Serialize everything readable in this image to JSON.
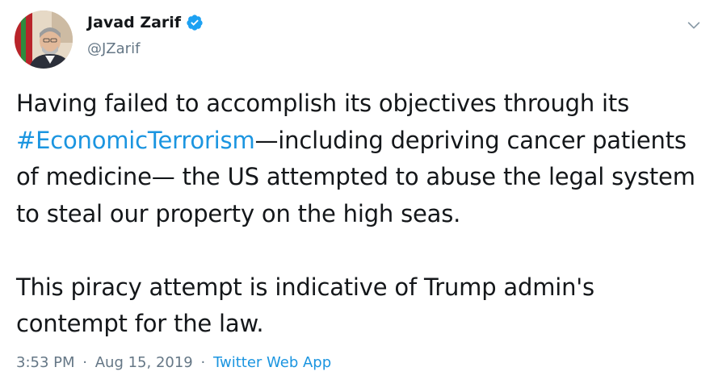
{
  "tweet": {
    "author": {
      "display_name": "Javad Zarif",
      "handle": "@JZarif",
      "verified_icon": "verified-badge-icon",
      "avatar_icon": "profile-photo"
    },
    "menu_icon": "chevron-down-icon",
    "text": {
      "part1": "Having failed to accomplish its objectives through its ",
      "hashtag": "#EconomicTerrorism",
      "part2": "—including depriving cancer patients of medicine— the US attempted to abuse the legal system to steal our property on the high seas.\n\nThis piracy attempt is indicative of Trump admin's contempt for the law."
    },
    "meta": {
      "time": "3:53 PM",
      "separator": "·",
      "date": "Aug 15, 2019",
      "source": "Twitter Web App"
    }
  },
  "colors": {
    "link": "#1b95e0",
    "secondary_text": "#657786",
    "primary_text": "#14171a",
    "verified": "#1da1f2"
  }
}
